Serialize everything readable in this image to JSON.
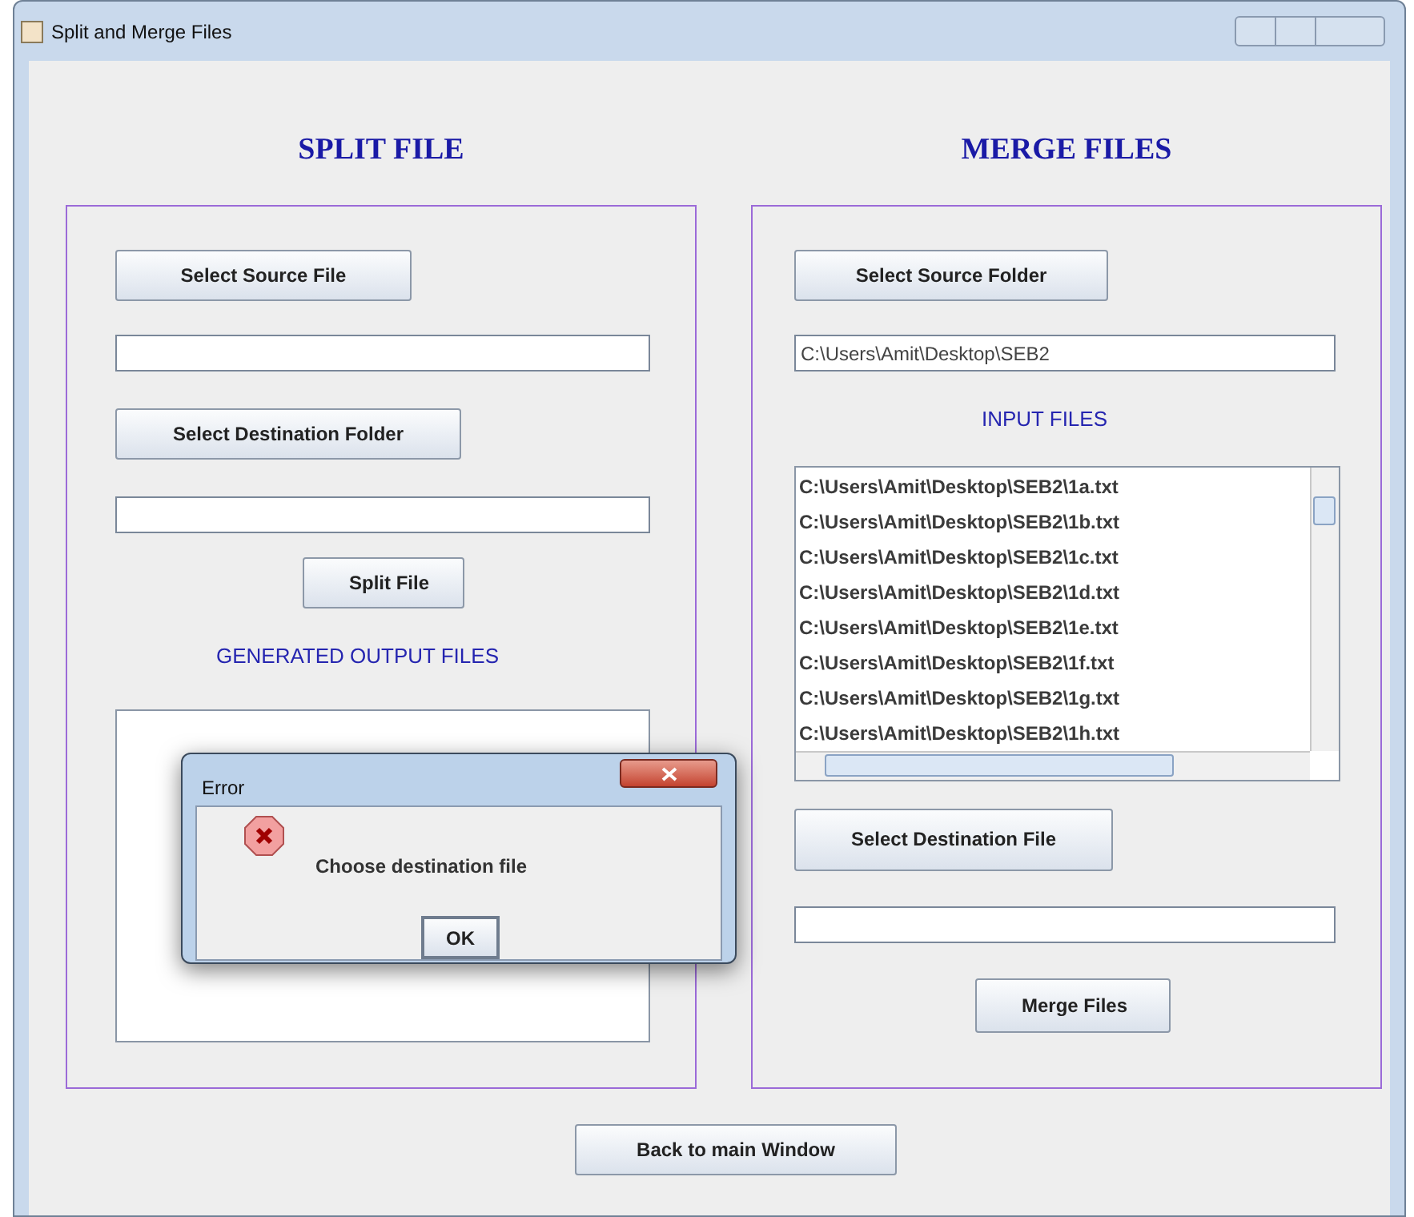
{
  "window": {
    "title": "Split and Merge Files"
  },
  "split": {
    "title": "SPLIT FILE",
    "source_button": "Select Source File",
    "destination_button": "Select Destination Folder",
    "split_button": "Split File",
    "output_label": "GENERATED OUTPUT FILES"
  },
  "merge": {
    "title": "MERGE FILES",
    "source_button": "Select Source Folder",
    "source_field": {
      "value": "C:\\Users\\Amit\\Desktop\\SEB2"
    },
    "input_label": "INPUT FILES",
    "input_files": [
      "C:\\Users\\Amit\\Desktop\\SEB2\\1a.txt",
      "C:\\Users\\Amit\\Desktop\\SEB2\\1b.txt",
      "C:\\Users\\Amit\\Desktop\\SEB2\\1c.txt",
      "C:\\Users\\Amit\\Desktop\\SEB2\\1d.txt",
      "C:\\Users\\Amit\\Desktop\\SEB2\\1e.txt",
      "C:\\Users\\Amit\\Desktop\\SEB2\\1f.txt",
      "C:\\Users\\Amit\\Desktop\\SEB2\\1g.txt",
      "C:\\Users\\Amit\\Desktop\\SEB2\\1h.txt"
    ],
    "destination_button": "Select Destination File",
    "merge_button": "Merge Files"
  },
  "back_button": "Back to main Window",
  "dialog": {
    "title": "Error",
    "message": "Choose destination file",
    "ok_button": "OK"
  }
}
